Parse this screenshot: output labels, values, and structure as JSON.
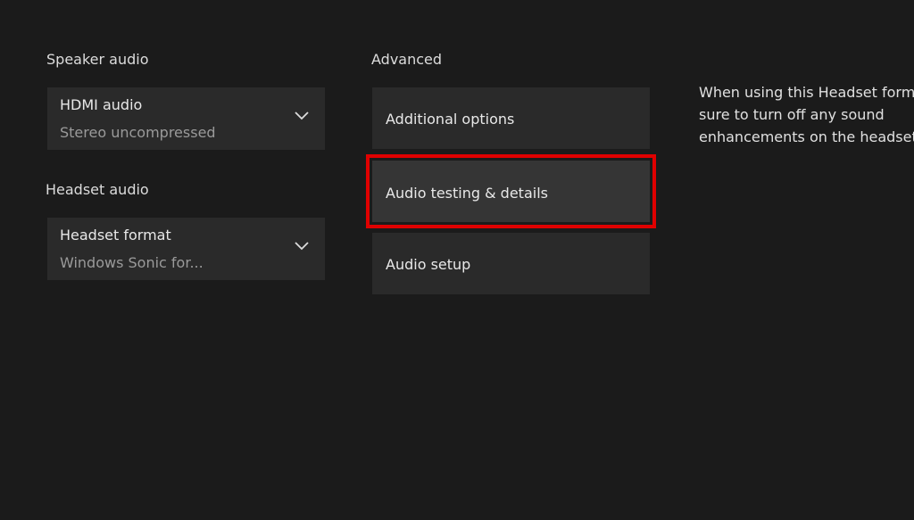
{
  "speaker_audio": {
    "title": "Speaker audio",
    "dropdown_label": "HDMI audio",
    "dropdown_value": "Stereo uncompressed"
  },
  "headset_audio": {
    "title": "Headset audio",
    "dropdown_label": "Headset format",
    "dropdown_value": "Windows Sonic for..."
  },
  "advanced": {
    "title": "Advanced",
    "items": [
      {
        "label": "Additional options"
      },
      {
        "label": "Audio testing & details"
      },
      {
        "label": "Audio setup"
      }
    ]
  },
  "description": {
    "line1": "When using this Headset form",
    "line2": "sure to turn off any sound",
    "line3": "enhancements on the headset"
  },
  "colors": {
    "background": "#1b1b1b",
    "tile": "#2a2a2a",
    "highlight": "#e00000"
  }
}
